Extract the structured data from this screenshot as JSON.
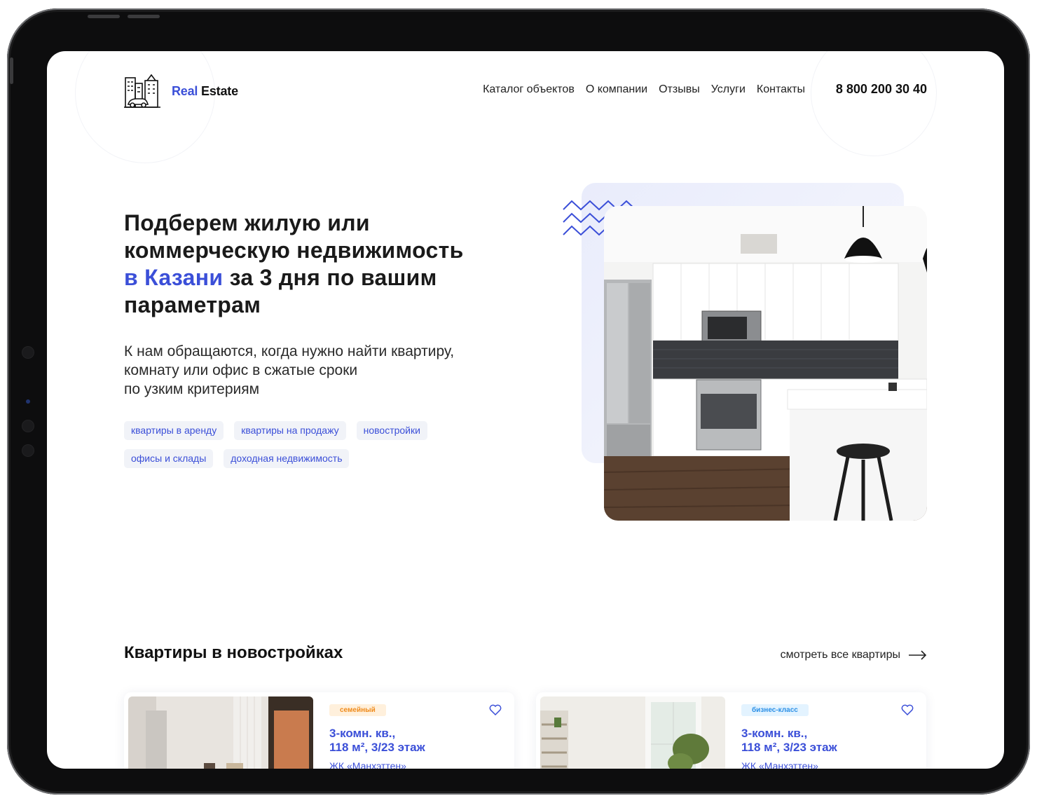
{
  "brand": {
    "name_accent": "Real",
    "name_rest": "Estate"
  },
  "nav": {
    "items": [
      "Каталог объектов",
      "О компании",
      "Отзывы",
      "Услуги",
      "Контакты"
    ],
    "phone": "8 800 200 30 40"
  },
  "hero": {
    "title_line1": "Подберем жилую или",
    "title_line2": "коммерческую недвижимость",
    "title_accent": "в Казани",
    "title_line3_rest": "за 3 дня по вашим",
    "title_line4": "параметрам",
    "subtitle_line1": "К нам обращаются, когда нужно найти квартиру,",
    "subtitle_line2": "комнату или офис в сжатые сроки",
    "subtitle_line3": "по узким критериям",
    "tags": [
      "квартиры в аренду",
      "квартиры на продажу",
      "новостройки",
      "офисы и склады",
      "доходная недвижимость"
    ]
  },
  "section": {
    "title": "Квартиры в новостройках",
    "see_all": "смотреть все квартиры"
  },
  "cards": [
    {
      "badge": "семейный",
      "title_line1": "3-комн. кв.,",
      "title_line2": "118 м², 3/23 этаж",
      "project": "ЖК «Манхэттен»"
    },
    {
      "badge": "бизнес-класс",
      "title_line1": "3-комн. кв.,",
      "title_line2": "118 м², 3/23 этаж",
      "project": "ЖК «Манхэттен»"
    }
  ],
  "colors": {
    "accent": "#3b4fd8",
    "tag_bg": "#f1f3f8",
    "badge_family": "#ef8a1a",
    "badge_business": "#2a8fe6"
  },
  "icons": [
    "buildings-logo-icon",
    "zigzag-decor-icon",
    "arrow-right-icon",
    "heart-icon"
  ]
}
